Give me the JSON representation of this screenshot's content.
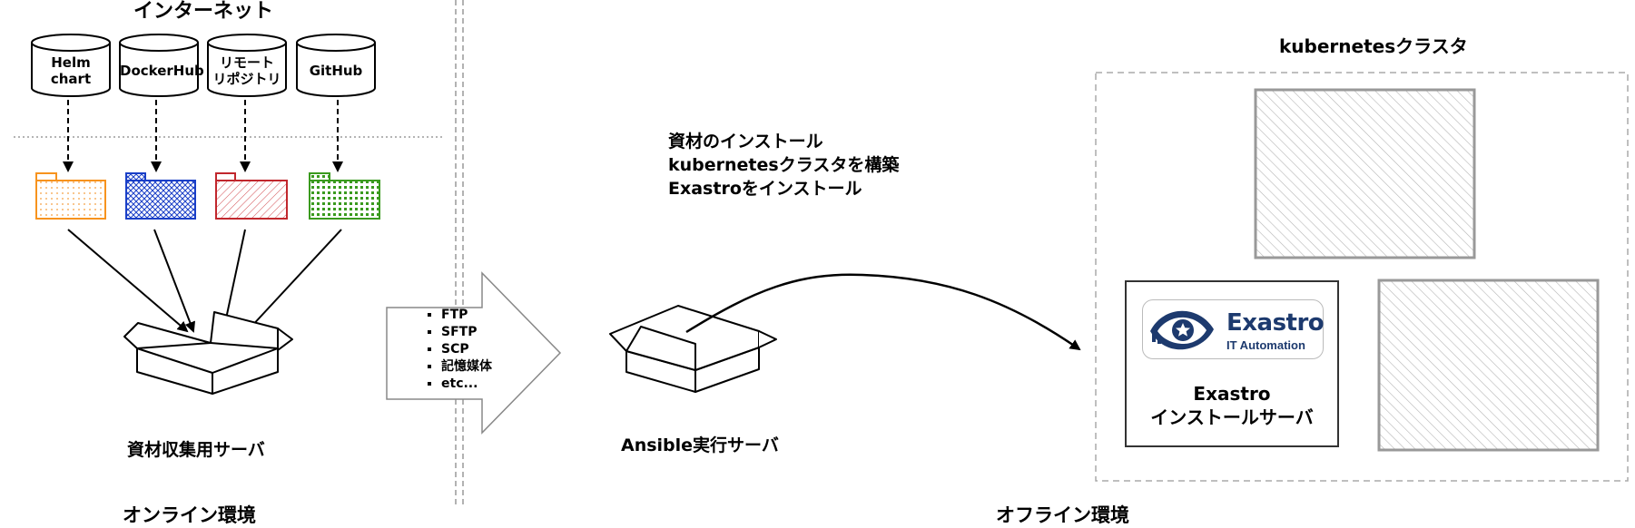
{
  "internet": {
    "title": "インターネット",
    "sources": [
      {
        "label": "Helm\nchart"
      },
      {
        "label": "DockerHub"
      },
      {
        "label": "リモート\nリポジトリ"
      },
      {
        "label": "GitHub"
      }
    ],
    "folder_colors": [
      "#f7931e",
      "#1a3fc7",
      "#c1272d",
      "#3a9a1e"
    ]
  },
  "collect_server": {
    "label": "資材収集用サーバ"
  },
  "transfer": {
    "protocols": [
      "FTP",
      "SFTP",
      "SCP",
      "記憶媒体",
      "etc..."
    ]
  },
  "ansible": {
    "steps": [
      "資材のインストール",
      "kubernetesクラスタを構築",
      "Exastroをインストール"
    ],
    "server_label": "Ansible実行サーバ"
  },
  "cluster": {
    "title": "kubernetesクラスタ",
    "exastro": {
      "logo_text": "Exastro",
      "logo_sub": "IT Automation",
      "label_line1": "Exastro",
      "label_line2": "インストールサーバ"
    }
  },
  "environments": {
    "online": "オンライン環境",
    "offline": "オフライン環境"
  }
}
